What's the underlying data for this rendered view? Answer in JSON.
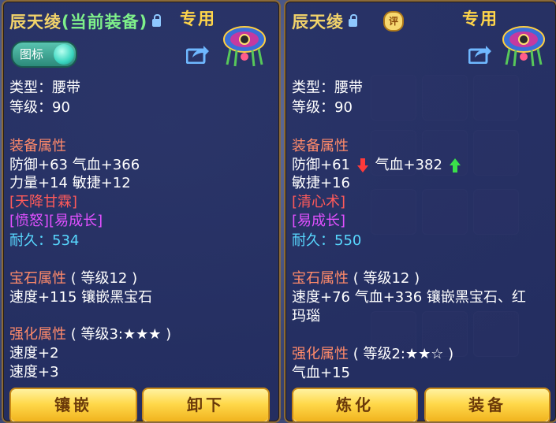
{
  "left": {
    "name": "辰天绫",
    "status": "(当前装备)",
    "special": "专用",
    "toggle_label": "图标",
    "type": "类型：腰带",
    "level": "等级：90",
    "equip_attr_header": "装备属性",
    "stat_line1": "防御+63 气血+366",
    "stat_line2": "力量+14 敏捷+12",
    "special_skill": "[天降甘霖]",
    "special_effect": "[愤怒][易成长]",
    "durability": "耐久：534",
    "gem_header": "宝石属性",
    "gem_level": "( 等级12 )",
    "gem_line": "速度+115 镶嵌黑宝石",
    "enhance_header": "强化属性",
    "enhance_level": "( 等级3:★★★ )",
    "enhance_line1": "速度+2",
    "enhance_line2": "速度+3",
    "btn1": "镶嵌",
    "btn2": "卸下"
  },
  "right": {
    "name": "辰天绫",
    "rate_badge": "评",
    "special": "专用",
    "type": "类型：腰带",
    "level": "等级：90",
    "equip_attr_header": "装备属性",
    "stat_def": "防御+61",
    "stat_hp": "气血+382",
    "stat_line2": "敏捷+16",
    "special_skill": "[清心术]",
    "special_effect": "[易成长]",
    "durability": "耐久：550",
    "gem_header": "宝石属性",
    "gem_level": "( 等级12 )",
    "gem_line1": "速度+76 气血+336 镶嵌黑宝石、红",
    "gem_line2": "玛瑙",
    "enhance_header": "强化属性",
    "enhance_level": "( 等级2:★★☆ )",
    "enhance_line1": "气血+15",
    "btn1": "炼化",
    "btn2": "装备"
  },
  "colors": {
    "title": "#f2d36a",
    "status": "#7ef08a",
    "section": "#ff8a6a",
    "skill": "#ff5a5a",
    "effect": "#e050ff",
    "durability": "#58d8ff",
    "button": "#ffd84a"
  },
  "icons": [
    "lock-icon",
    "share-icon",
    "belt-item-icon",
    "down-arrow-icon",
    "up-arrow-icon",
    "rating-badge-icon"
  ]
}
